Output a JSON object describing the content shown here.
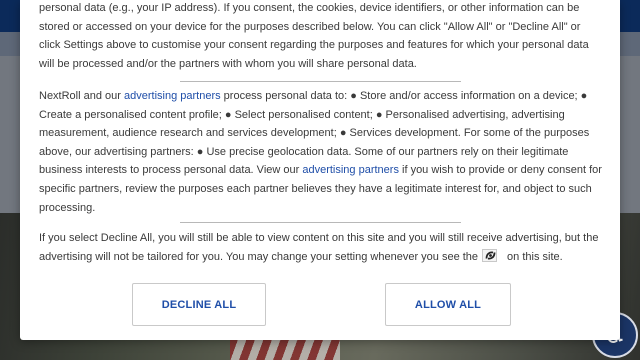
{
  "background": {
    "accessibility_icon": "accessibility-icon",
    "colors": {
      "topbar": "#0b2a5a",
      "accessibility": "#1b3566"
    }
  },
  "consent": {
    "intro": "personal data (e.g., your IP address). If you consent, the cookies, device identifiers, or other information can be stored or accessed on your device for the purposes described below. You can click \"Allow All\" or \"Decline All\" or click Settings above to customise your consent regarding the purposes and features for which your personal data will be processed and/or the partners with whom you will share personal data.",
    "partners_text_1": "NextRoll and our ",
    "partners_link_1": "advertising partners",
    "partners_text_2": " process personal data to: ● Store and/or access information on a device; ● Create a personalised content profile; ● Select personalised content; ● Personalised advertising, advertising measurement, audience research and services development; ● Services development. For some of the purposes above, our advertising partners: ● Use precise geolocation data. Some of our partners rely on their legitimate business interests to process personal data. View our ",
    "partners_link_2": "advertising partners",
    "partners_text_3": " if you wish to provide or deny consent for specific partners, review the purposes each partner believes they have a legitimate interest for, and object to such processing.",
    "decline_note_1": "If you select Decline All, you will still be able to view content on this site and you will still receive advertising, but the advertising will not be tailored for you. You may change your setting whenever you see the",
    "settings_icon": "settings-icon",
    "decline_note_2": "on this site.",
    "decline_button": "DECLINE ALL",
    "allow_button": "ALLOW ALL",
    "colors": {
      "link": "#1f4ea8",
      "text": "#3a3a3a"
    }
  }
}
